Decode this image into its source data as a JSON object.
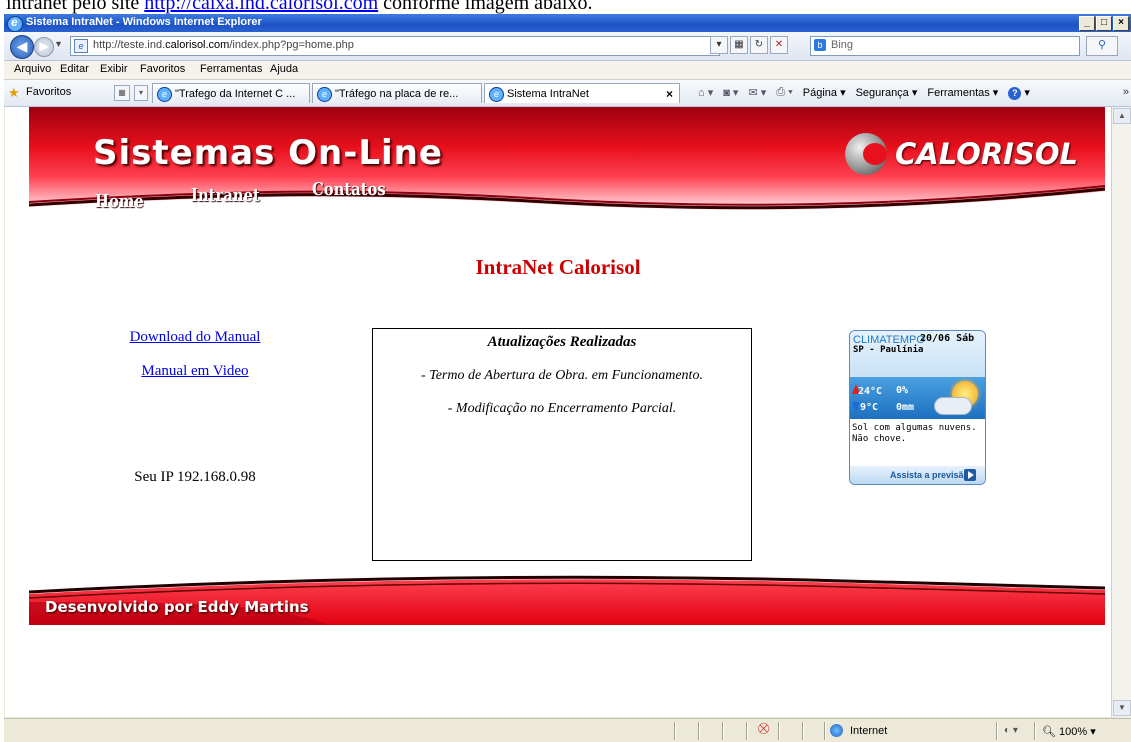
{
  "doc_fragment": {
    "before_link": "intranet pelo site",
    "link": "http://caixa.ind.calorisol.com",
    "after_link": "conforme imagem abaixo."
  },
  "window": {
    "title": "Sistema IntraNet - Windows Internet Explorer",
    "controls": [
      "_",
      "□",
      "×"
    ]
  },
  "address_bar": {
    "url_prefix": "http://teste.ind.",
    "url_domain": "calorisol.com",
    "url_suffix": "/index.php?pg=home.php",
    "search_placeholder": "Bing"
  },
  "menu": [
    "Arquivo",
    "Editar",
    "Exibir",
    "Favoritos",
    "Ferramentas",
    "Ajuda"
  ],
  "favorites_bar": {
    "label": "Favoritos",
    "tabs": [
      {
        "label": "\"Trafego da Internet C ..."
      },
      {
        "label": "\"Tráfego na placa de re..."
      },
      {
        "label": "Sistema IntraNet",
        "close": "×"
      }
    ],
    "commands": {
      "page": "Página",
      "security": "Segurança",
      "tools": "Ferramentas"
    }
  },
  "site": {
    "title": "Sistemas On-Line",
    "logo_text": "CALORISOL",
    "nav": [
      "Home",
      "Intranet",
      "Contatos"
    ],
    "heading": "IntraNet Calorisol",
    "links": [
      "Download do Manual",
      "Manual em Video"
    ],
    "ip_text": "Seu IP 192.168.0.98",
    "updates": {
      "title": "Atualizações Realizadas",
      "items": [
        "- Termo de Abertura de Obra. em Funcionamento.",
        "- Modificação no Encerramento Parcial."
      ]
    },
    "weather": {
      "brand": "CLIMATEMPO",
      "date": "20/06 Sáb",
      "city": "SP - Paulínia",
      "max": "24°C",
      "rain_chance": "0%",
      "min": "9°C",
      "rain_mm": "0mm",
      "description": "Sol com algumas nuvens. Não chove.",
      "cta": "Assista a previsão"
    },
    "footer_credit": "Desenvolvido por Eddy Martins"
  },
  "status_bar": {
    "zone": "Internet",
    "zoom": "100%"
  },
  "colors": {
    "banner_red": "#e8101c",
    "heading_red": "#cc0000",
    "link_blue": "#0000ee",
    "weather_blue": "#1e70c0"
  }
}
